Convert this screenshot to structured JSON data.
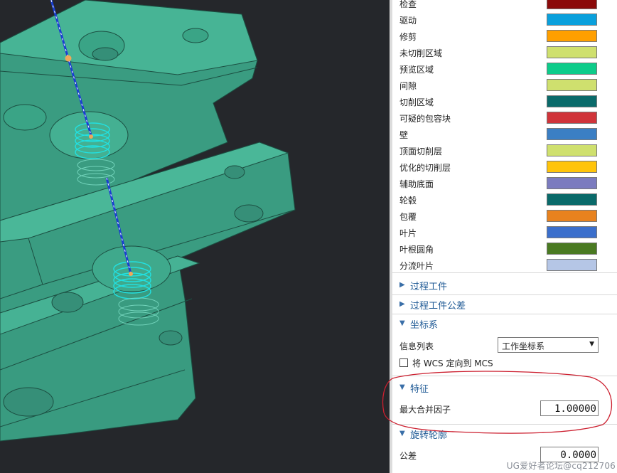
{
  "color_settings": [
    {
      "label": "检查",
      "color": "#8b0a0a"
    },
    {
      "label": "驱动",
      "color": "#0aa0dc"
    },
    {
      "label": "修剪",
      "color": "#ff9f00"
    },
    {
      "label": "未切削区域",
      "color": "#cfe06e"
    },
    {
      "label": "预览区域",
      "color": "#0dcc8a"
    },
    {
      "label": "间隙",
      "color": "#cfe06e"
    },
    {
      "label": "切削区域",
      "color": "#0a6a6a"
    },
    {
      "label": "可疑的包容块",
      "color": "#d0343a"
    },
    {
      "label": "壁",
      "color": "#3b7fc4"
    },
    {
      "label": "顶面切削层",
      "color": "#cfe06e"
    },
    {
      "label": "优化的切削层",
      "color": "#ffc40a"
    },
    {
      "label": "辅助底面",
      "color": "#7b7bbf"
    },
    {
      "label": "轮毂",
      "color": "#0a6a6a"
    },
    {
      "label": "包覆",
      "color": "#e8821e"
    },
    {
      "label": "叶片",
      "color": "#3b6fcc"
    },
    {
      "label": "叶根圆角",
      "color": "#4a7a22"
    },
    {
      "label": "分流叶片",
      "color": "#b5c6e6"
    }
  ],
  "sections": {
    "process_workpiece": {
      "title": "过程工件",
      "expanded": false
    },
    "process_workpiece_tolerance": {
      "title": "过程工件公差",
      "expanded": false
    },
    "coordinate_system": {
      "title": "坐标系",
      "expanded": true,
      "info_list_label": "信息列表",
      "info_list_value": "工作坐标系",
      "wcs_checkbox_label": "将 WCS 定向到 MCS",
      "wcs_checkbox_checked": false
    },
    "features": {
      "title": "特征",
      "expanded": true,
      "max_merge_factor_label": "最大合并因子",
      "max_merge_factor_value": "1.00000"
    },
    "rotation_profile": {
      "title": "旋转轮廓",
      "expanded": true,
      "tolerance_label": "公差",
      "tolerance_value": "0.0000"
    }
  },
  "watermark": "UG爱好者论坛@cq212706",
  "colors": {
    "viewport_bg": "#25272b",
    "model_fill": "#3fa98c",
    "tool_path": "#1a3fd0",
    "thread_highlight": "#22e0e0",
    "annotation_circle": "#cc1f2f"
  }
}
